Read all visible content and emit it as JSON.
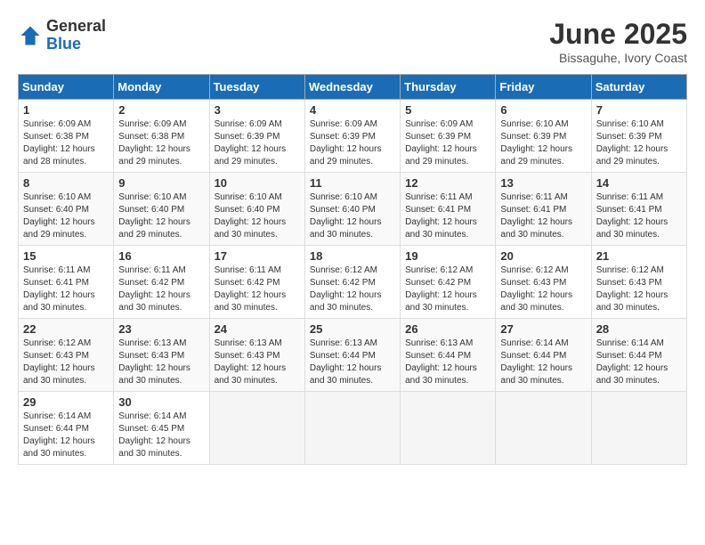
{
  "header": {
    "logo_general": "General",
    "logo_blue": "Blue",
    "month_title": "June 2025",
    "subtitle": "Bissaguhe, Ivory Coast"
  },
  "days_of_week": [
    "Sunday",
    "Monday",
    "Tuesday",
    "Wednesday",
    "Thursday",
    "Friday",
    "Saturday"
  ],
  "weeks": [
    [
      {
        "day": 1,
        "sunrise": "6:09 AM",
        "sunset": "6:38 PM",
        "daylight": "12 hours and 28 minutes."
      },
      {
        "day": 2,
        "sunrise": "6:09 AM",
        "sunset": "6:38 PM",
        "daylight": "12 hours and 29 minutes."
      },
      {
        "day": 3,
        "sunrise": "6:09 AM",
        "sunset": "6:39 PM",
        "daylight": "12 hours and 29 minutes."
      },
      {
        "day": 4,
        "sunrise": "6:09 AM",
        "sunset": "6:39 PM",
        "daylight": "12 hours and 29 minutes."
      },
      {
        "day": 5,
        "sunrise": "6:09 AM",
        "sunset": "6:39 PM",
        "daylight": "12 hours and 29 minutes."
      },
      {
        "day": 6,
        "sunrise": "6:10 AM",
        "sunset": "6:39 PM",
        "daylight": "12 hours and 29 minutes."
      },
      {
        "day": 7,
        "sunrise": "6:10 AM",
        "sunset": "6:39 PM",
        "daylight": "12 hours and 29 minutes."
      }
    ],
    [
      {
        "day": 8,
        "sunrise": "6:10 AM",
        "sunset": "6:40 PM",
        "daylight": "12 hours and 29 minutes."
      },
      {
        "day": 9,
        "sunrise": "6:10 AM",
        "sunset": "6:40 PM",
        "daylight": "12 hours and 29 minutes."
      },
      {
        "day": 10,
        "sunrise": "6:10 AM",
        "sunset": "6:40 PM",
        "daylight": "12 hours and 30 minutes."
      },
      {
        "day": 11,
        "sunrise": "6:10 AM",
        "sunset": "6:40 PM",
        "daylight": "12 hours and 30 minutes."
      },
      {
        "day": 12,
        "sunrise": "6:11 AM",
        "sunset": "6:41 PM",
        "daylight": "12 hours and 30 minutes."
      },
      {
        "day": 13,
        "sunrise": "6:11 AM",
        "sunset": "6:41 PM",
        "daylight": "12 hours and 30 minutes."
      },
      {
        "day": 14,
        "sunrise": "6:11 AM",
        "sunset": "6:41 PM",
        "daylight": "12 hours and 30 minutes."
      }
    ],
    [
      {
        "day": 15,
        "sunrise": "6:11 AM",
        "sunset": "6:41 PM",
        "daylight": "12 hours and 30 minutes."
      },
      {
        "day": 16,
        "sunrise": "6:11 AM",
        "sunset": "6:42 PM",
        "daylight": "12 hours and 30 minutes."
      },
      {
        "day": 17,
        "sunrise": "6:11 AM",
        "sunset": "6:42 PM",
        "daylight": "12 hours and 30 minutes."
      },
      {
        "day": 18,
        "sunrise": "6:12 AM",
        "sunset": "6:42 PM",
        "daylight": "12 hours and 30 minutes."
      },
      {
        "day": 19,
        "sunrise": "6:12 AM",
        "sunset": "6:42 PM",
        "daylight": "12 hours and 30 minutes."
      },
      {
        "day": 20,
        "sunrise": "6:12 AM",
        "sunset": "6:43 PM",
        "daylight": "12 hours and 30 minutes."
      },
      {
        "day": 21,
        "sunrise": "6:12 AM",
        "sunset": "6:43 PM",
        "daylight": "12 hours and 30 minutes."
      }
    ],
    [
      {
        "day": 22,
        "sunrise": "6:12 AM",
        "sunset": "6:43 PM",
        "daylight": "12 hours and 30 minutes."
      },
      {
        "day": 23,
        "sunrise": "6:13 AM",
        "sunset": "6:43 PM",
        "daylight": "12 hours and 30 minutes."
      },
      {
        "day": 24,
        "sunrise": "6:13 AM",
        "sunset": "6:43 PM",
        "daylight": "12 hours and 30 minutes."
      },
      {
        "day": 25,
        "sunrise": "6:13 AM",
        "sunset": "6:44 PM",
        "daylight": "12 hours and 30 minutes."
      },
      {
        "day": 26,
        "sunrise": "6:13 AM",
        "sunset": "6:44 PM",
        "daylight": "12 hours and 30 minutes."
      },
      {
        "day": 27,
        "sunrise": "6:14 AM",
        "sunset": "6:44 PM",
        "daylight": "12 hours and 30 minutes."
      },
      {
        "day": 28,
        "sunrise": "6:14 AM",
        "sunset": "6:44 PM",
        "daylight": "12 hours and 30 minutes."
      }
    ],
    [
      {
        "day": 29,
        "sunrise": "6:14 AM",
        "sunset": "6:44 PM",
        "daylight": "12 hours and 30 minutes."
      },
      {
        "day": 30,
        "sunrise": "6:14 AM",
        "sunset": "6:45 PM",
        "daylight": "12 hours and 30 minutes."
      },
      null,
      null,
      null,
      null,
      null
    ]
  ],
  "labels": {
    "sunrise": "Sunrise:",
    "sunset": "Sunset:",
    "daylight": "Daylight:"
  }
}
